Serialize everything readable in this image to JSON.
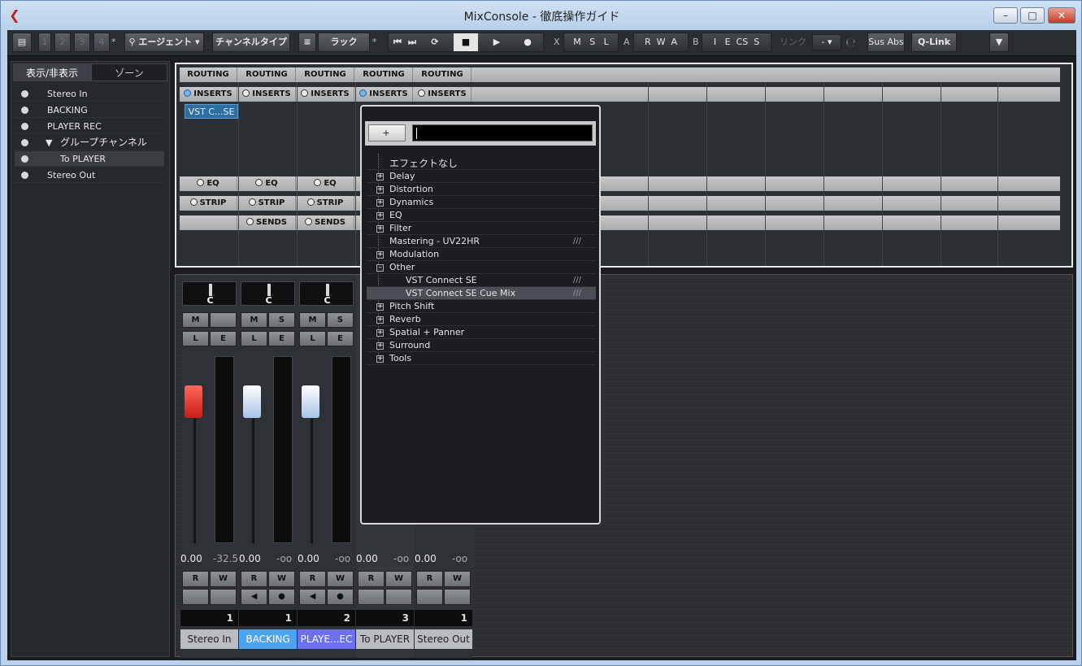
{
  "window": {
    "title": "MixConsole - 徹底操作ガイド"
  },
  "toolbar": {
    "pages": [
      "1",
      "2",
      "3",
      "4"
    ],
    "star": "*",
    "agent_label": "エージェント",
    "channel_type_label": "チャンネルタイプ",
    "rack_label": "ラック",
    "x": "X",
    "m": "M",
    "s": "S",
    "l": "L",
    "a": "A",
    "r": "R",
    "w": "W",
    "a2": "A",
    "b": "B",
    "i": "I",
    "e": "E",
    "cs": "CS",
    "s2": "S",
    "link_label": "リンク",
    "link_value": "-",
    "sus_abs": "Sus Abs",
    "qlink": "Q-Link"
  },
  "left_panel": {
    "tab_visibility": "表示/非表示",
    "tab_zones": "ゾーン",
    "items": [
      {
        "label": "Stereo In"
      },
      {
        "label": "BACKING"
      },
      {
        "label": "PLAYER REC"
      },
      {
        "label": "グループチャンネル"
      },
      {
        "label": "To PLAYER"
      },
      {
        "label": "Stereo Out"
      }
    ]
  },
  "rack": {
    "routing": "ROUTING",
    "inserts": "INSERTS",
    "eq": "EQ",
    "strip": "STRIP",
    "sends": "SENDS",
    "vst_slot": "VST C...SE"
  },
  "channels": [
    {
      "name": "Stereo In",
      "pan": "C",
      "m": "M",
      "s": "",
      "l": "L",
      "e": "E",
      "fader_value": "0.00",
      "meter_value": "-32.5",
      "number": "1",
      "color": "#b9bcc0",
      "cap": "red"
    },
    {
      "name": "BACKING",
      "pan": "C",
      "m": "M",
      "s": "S",
      "l": "L",
      "e": "E",
      "fader_value": "0.00",
      "meter_value": "-oo",
      "number": "1",
      "color": "#4da3ee",
      "cap": "white"
    },
    {
      "name": "PLAYE...EC",
      "pan": "C",
      "m": "M",
      "s": "S",
      "l": "L",
      "e": "E",
      "fader_value": "0.00",
      "meter_value": "-oo",
      "number": "2",
      "color": "#6b6ff0",
      "cap": "white"
    },
    {
      "name": "To PLAYER",
      "pan": "",
      "m": "",
      "s": "",
      "l": "",
      "e": "",
      "fader_value": "0.00",
      "meter_value": "-oo",
      "number": "3",
      "color": "#b9bcc0",
      "cap": "none"
    },
    {
      "name": "Stereo Out",
      "pan": "",
      "m": "",
      "s": "",
      "l": "",
      "e": "",
      "fader_value": "0.00",
      "meter_value": "-oo",
      "number": "1",
      "color": "#b9bcc0",
      "cap": "none"
    }
  ],
  "rw": {
    "r": "R",
    "w": "W"
  },
  "popup": {
    "plus_minus": "+ -",
    "none": "エフェクトなし",
    "items": [
      {
        "label": "Delay",
        "expandable": true
      },
      {
        "label": "Distortion",
        "expandable": true
      },
      {
        "label": "Dynamics",
        "expandable": true
      },
      {
        "label": "EQ",
        "expandable": true
      },
      {
        "label": "Filter",
        "expandable": true
      },
      {
        "label": "Mastering - UV22HR",
        "expandable": false,
        "slashes": "///"
      },
      {
        "label": "Modulation",
        "expandable": true
      },
      {
        "label": "Other",
        "expandable": true,
        "expanded": true
      },
      {
        "label": "VST Connect SE",
        "child": true,
        "slashes": "///"
      },
      {
        "label": "VST Connect SE Cue Mix",
        "child": true,
        "slashes": "///",
        "selected": true
      },
      {
        "label": "Pitch Shift",
        "expandable": true
      },
      {
        "label": "Reverb",
        "expandable": true
      },
      {
        "label": "Spatial + Panner",
        "expandable": true
      },
      {
        "label": "Surround",
        "expandable": true
      },
      {
        "label": "Tools",
        "expandable": true
      }
    ]
  }
}
